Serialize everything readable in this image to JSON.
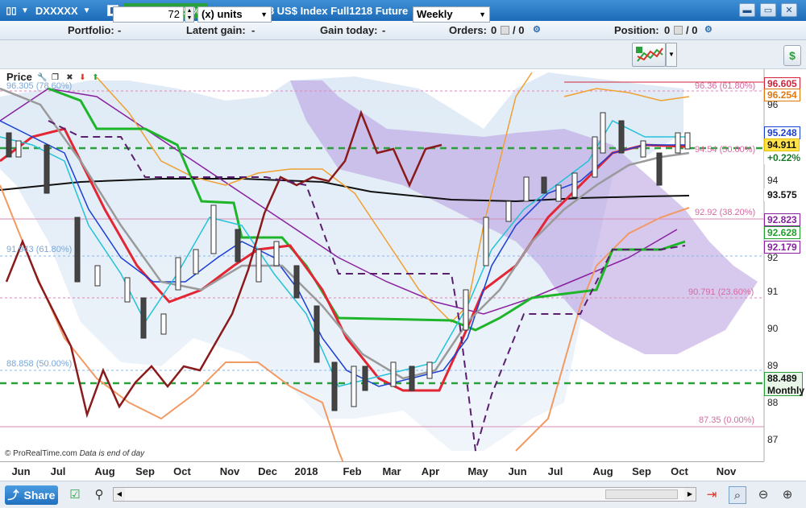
{
  "title_bar": {
    "ticker": "DXXXXX",
    "price_badge": "94.911 (+0.22%)",
    "description": "12-Oct-2018 US$ Index Full1218 Future"
  },
  "info_bar": {
    "portfolio_label": "Portfolio:",
    "portfolio_value": "-",
    "latent_gain_label": "Latent gain:",
    "latent_gain_value": "-",
    "gain_today_label": "Gain today:",
    "gain_today_value": "-",
    "orders_label": "Orders:",
    "orders_value_1": "0",
    "orders_value_2": "/ 0",
    "position_label": "Position:",
    "position_value_1": "0",
    "position_value_2": "/ 0"
  },
  "controls": {
    "units_value": "72",
    "units_select": "(x) units",
    "timeframe_select": "Weekly"
  },
  "chart": {
    "panel_label": "Price",
    "copyright": "© ProRealTime.com",
    "data_note": "Data is end of day",
    "x_labels": [
      "Jun",
      "Jul",
      "Aug",
      "Sep",
      "Oct",
      "Nov",
      "Dec",
      "2018",
      "Feb",
      "Mar",
      "Apr",
      "May",
      "Jun",
      "Jul",
      "Aug",
      "Sep",
      "Oct",
      "Nov"
    ],
    "y_ticks": [
      "96",
      "94",
      "93",
      "92",
      "91",
      "90",
      "89",
      "88",
      "87"
    ],
    "price_labels": {
      "p1": "96.605",
      "p2": "96.254",
      "p3": "95.248",
      "p4": "94.911",
      "p5": "+0.22%",
      "p6": "93.575",
      "p7": "92.823",
      "p8": "92.628",
      "p9": "92.179",
      "p10": "88.489",
      "p11": "Monthly"
    },
    "fib_labels": {
      "f1": "96.36 (61.80%)",
      "f2": "94.54 (50.00%)",
      "f3": "92.92 (38.20%)",
      "f4": "90.791 (23.60%)",
      "f5": "87.35 (0.00%)",
      "f6": "96.305 (78.60%)",
      "f7": "91.943 (61.80%)",
      "f8": "88.858 (50.00%)"
    }
  },
  "bottom_bar": {
    "share_label": "Share"
  }
}
